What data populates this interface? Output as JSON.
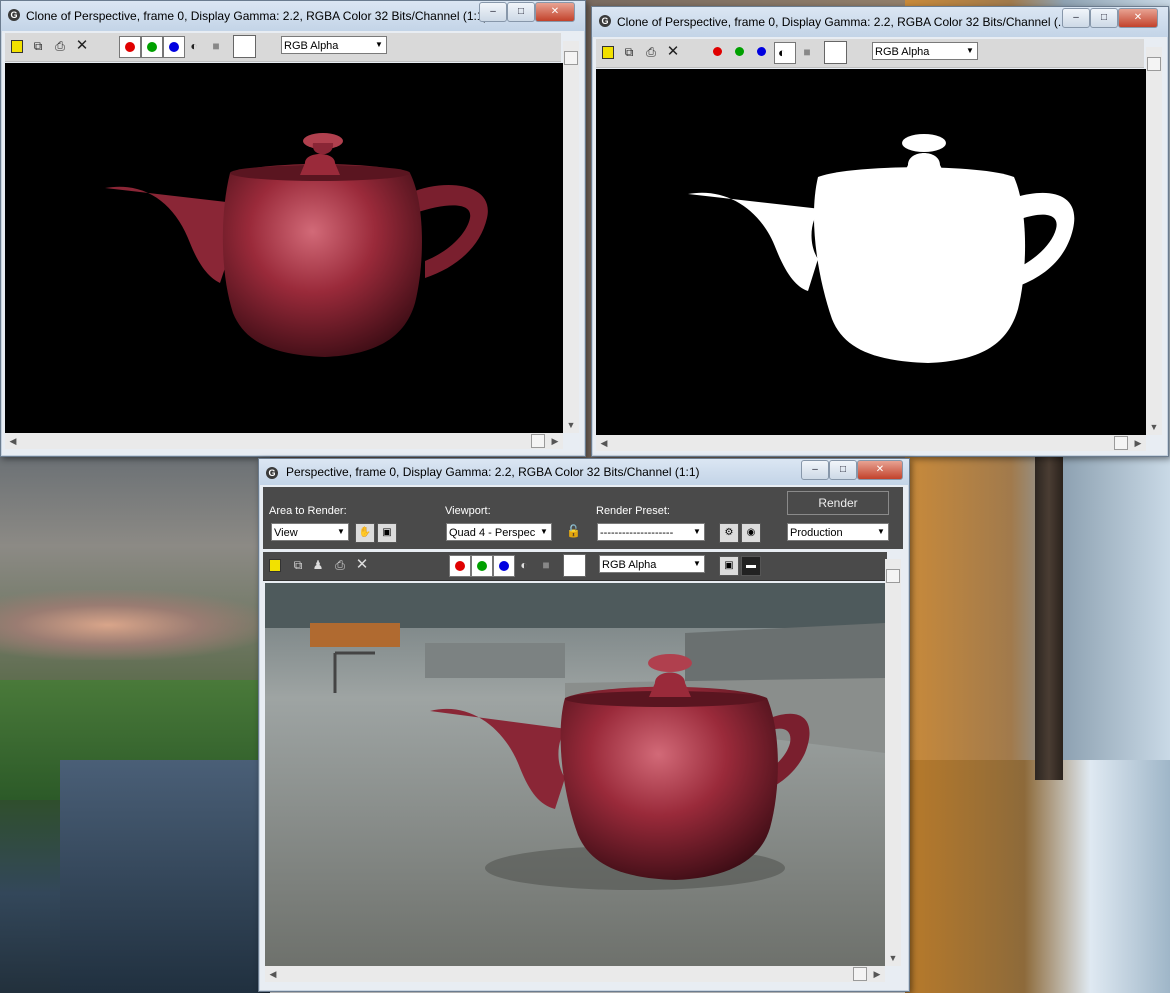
{
  "windows": {
    "clone1": {
      "title": "Clone of Perspective, frame 0, Display Gamma: 2.2, RGBA Color 32 Bits/Channel (1:1)",
      "channel_select": "RGB Alpha"
    },
    "clone2": {
      "title": "Clone of Perspective, frame 0, Display Gamma: 2.2, RGBA Color 32 Bits/Channel (...",
      "channel_select": "RGB Alpha"
    },
    "main": {
      "title": "Perspective, frame 0, Display Gamma: 2.2, RGBA Color 32 Bits/Channel (1:1)",
      "area_label": "Area to Render:",
      "area_value": "View",
      "viewport_label": "Viewport:",
      "viewport_value": "Quad 4 - Perspec",
      "preset_label": "Render Preset:",
      "preset_value": "--------------------",
      "render_button": "Render",
      "mode_value": "Production",
      "channel_select": "RGB Alpha"
    }
  },
  "colors": {
    "teapot": "#9a2a3a",
    "red_channel": "#e00000",
    "green_channel": "#00a000",
    "blue_channel": "#0000e0"
  }
}
